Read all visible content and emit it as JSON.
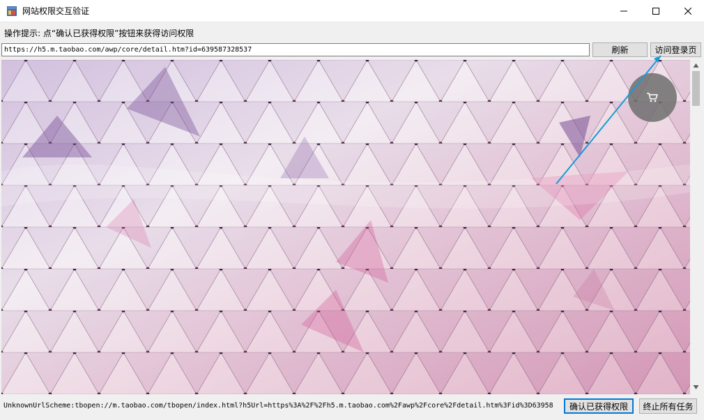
{
  "window": {
    "title": "网站权限交互验证",
    "controls": [
      "minimize-icon",
      "maximize-icon",
      "close-icon"
    ]
  },
  "hint": "操作提示: 点“确认已获得权限”按钮来获得访问权限",
  "toolbar": {
    "url_value": "https://h5.m.taobao.com/awp/core/detail.htm?id=639587328537",
    "refresh_label": "刷新",
    "visit_login_label": "访问登录页"
  },
  "browser": {
    "content": "pink-purple geometric triangle pattern product image",
    "cart_icon": "cart-icon"
  },
  "annotation": {
    "color": "#1a9ad6"
  },
  "status": {
    "text": "UnknownUrlScheme:tbopen://m.taobao.com/tbopen/index.html?h5Url=https%3A%2F%2Fh5.m.taobao.com%2Fawp%2Fcore%2Fdetail.htm%3Fid%3D63958"
  },
  "actions": {
    "confirm_label": "确认已获得权限",
    "stop_label": "终止所有任务"
  }
}
